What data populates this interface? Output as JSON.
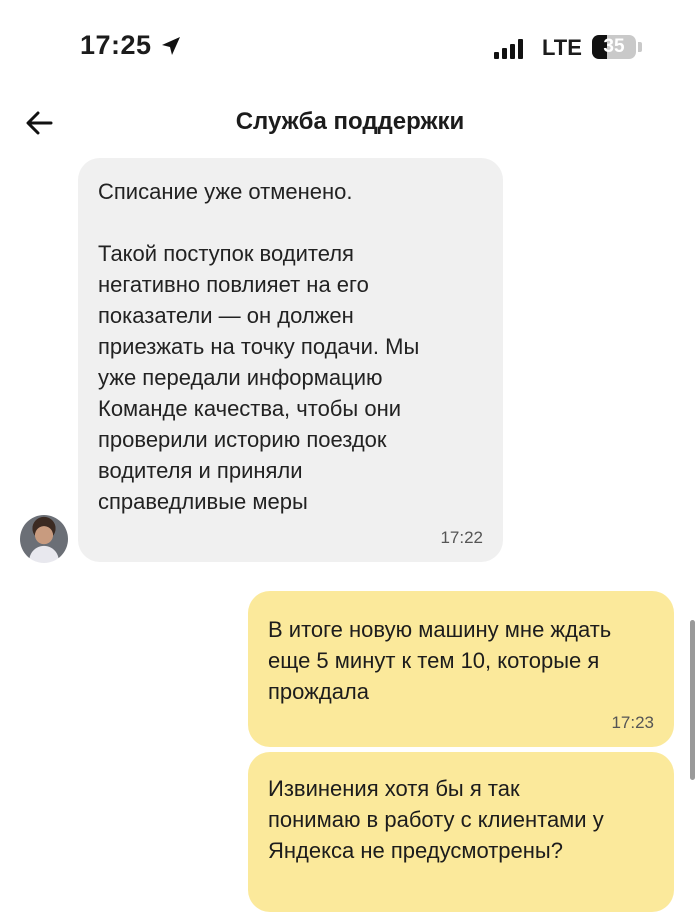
{
  "status_bar": {
    "time": "17:25",
    "network": "LTE",
    "battery": "35",
    "battery_fraction": 0.35,
    "signal_bars": 4,
    "icons": [
      "location-arrow-icon",
      "signal-icon",
      "battery-icon"
    ]
  },
  "header": {
    "title": "Служба поддержки",
    "back_icon": "arrow-left-icon"
  },
  "messages": [
    {
      "direction": "incoming",
      "text": "Списание уже отменено.\n\nТакой поступок водителя\nнегативно повлияет на его\nпоказатели — он должен\nприезжать на точку подачи. Мы\nуже передали информацию\nКоманде качества, чтобы они\nпроверили историю поездок\nводителя и приняли\nсправедливые меры",
      "time": "17:22"
    },
    {
      "direction": "outgoing",
      "text": "В итоге новую машину мне ждать\nеще 5 минут к тем 10, которые я\nпрождала",
      "time": "17:23"
    },
    {
      "direction": "outgoing",
      "text": "Извинения хотя бы я так\nпонимаю в работу с клиентами у\nЯндекса не предусмотрены?",
      "time": ""
    }
  ],
  "colors": {
    "incoming_bubble": "#f0f0f0",
    "outgoing_bubble": "#fbe99b",
    "text": "#1c1c1c"
  }
}
